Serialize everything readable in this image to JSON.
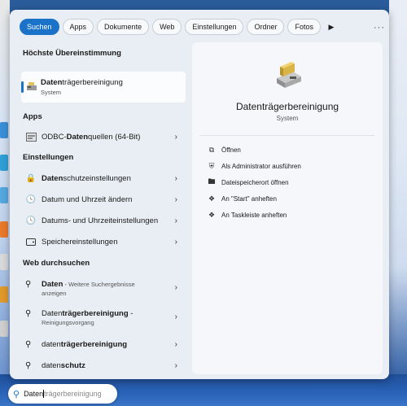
{
  "filters": {
    "items": [
      "Suchen",
      "Apps",
      "Dokumente",
      "Web",
      "Einstellungen",
      "Ordner",
      "Fotos"
    ],
    "play_icon": "play-icon",
    "more_icon": "more-icon"
  },
  "best_match": {
    "heading": "Höchste Übereinstimmung",
    "title_bold": "Daten",
    "title_rest": "trägerbereinigung",
    "subtitle": "System"
  },
  "apps": {
    "heading": "Apps",
    "items": [
      {
        "bold": "ODBC-",
        "b2": "Daten",
        "rest": "quellen (64-Bit)",
        "icon": "odbc-icon"
      }
    ]
  },
  "settings": {
    "heading": "Einstellungen",
    "items": [
      {
        "bold": "Daten",
        "rest": "schutzeinstellungen",
        "icon": "lock-icon"
      },
      {
        "bold": "",
        "rest": "Datum und Uhrzeit ändern",
        "icon": "clock-icon"
      },
      {
        "bold": "",
        "rest": "Datums- und Uhrzeiteinstellungen",
        "icon": "clock-icon"
      },
      {
        "bold": "",
        "rest": "Speichereinstellungen",
        "icon": "storage-icon"
      }
    ]
  },
  "web": {
    "heading": "Web durchsuchen",
    "items": [
      {
        "bold": "Daten",
        "rest": " - Weitere Suchergebnisse",
        "sub": "anzeigen"
      },
      {
        "bold": "Daten",
        "rest_bold": "trägerbereinigung",
        "tail": " -",
        "sub": "Reinigungsvorgang"
      },
      {
        "bold": "daten",
        "rest_bold": "trägerbereinigung",
        "tail": "",
        "sub": ""
      },
      {
        "bold": "daten",
        "rest_bold": "schutz",
        "tail": "",
        "sub": ""
      }
    ]
  },
  "detail": {
    "title": "Datenträgerbereinigung",
    "subtitle": "System",
    "actions": [
      {
        "label": "Öffnen",
        "icon": "open-icon"
      },
      {
        "label": "Als Administrator ausführen",
        "icon": "shield-icon"
      },
      {
        "label": "Dateispeicherort öffnen",
        "icon": "folder-icon"
      },
      {
        "label": "An \"Start\" anheften",
        "icon": "pin-icon"
      },
      {
        "label": "An Taskleiste anheften",
        "icon": "pin-icon"
      }
    ]
  },
  "search": {
    "typed": "Daten",
    "hint": "trägerbereinigung"
  },
  "colors": {
    "accent": "#1a73c9",
    "panel": "#e9eef4"
  }
}
